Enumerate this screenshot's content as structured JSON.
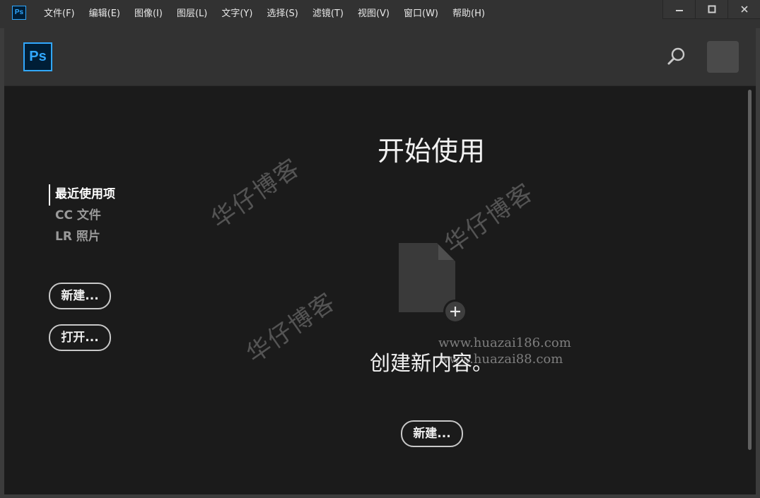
{
  "app": {
    "icon_text": "Ps"
  },
  "menu": [
    "文件(F)",
    "编辑(E)",
    "图像(I)",
    "图层(L)",
    "文字(Y)",
    "选择(S)",
    "滤镜(T)",
    "视图(V)",
    "窗口(W)",
    "帮助(H)"
  ],
  "window_controls": {
    "minimize": "—",
    "maximize": "□",
    "close": "✕"
  },
  "header": {
    "logo_text": "Ps",
    "search_icon": "search-icon",
    "avatar_icon": "avatar"
  },
  "sidebar": {
    "items": [
      {
        "label": "最近使用项",
        "active": true
      },
      {
        "label": "CC 文件",
        "active": false
      },
      {
        "label": "LR 照片",
        "active": false
      }
    ],
    "new_label": "新建...",
    "open_label": "打开..."
  },
  "main": {
    "title": "开始使用",
    "create_text": "创建新内容。",
    "new_label": "新建...",
    "doc_icon": "new-document-icon"
  },
  "watermark": {
    "text": "华仔博客",
    "url1": "www.huazai186.com",
    "url2": "www.huazai88.com"
  },
  "colors": {
    "accent": "#31a8ff",
    "logo_bg": "#001e36",
    "content_bg": "#1b1b1b",
    "chrome_bg": "#323232"
  }
}
